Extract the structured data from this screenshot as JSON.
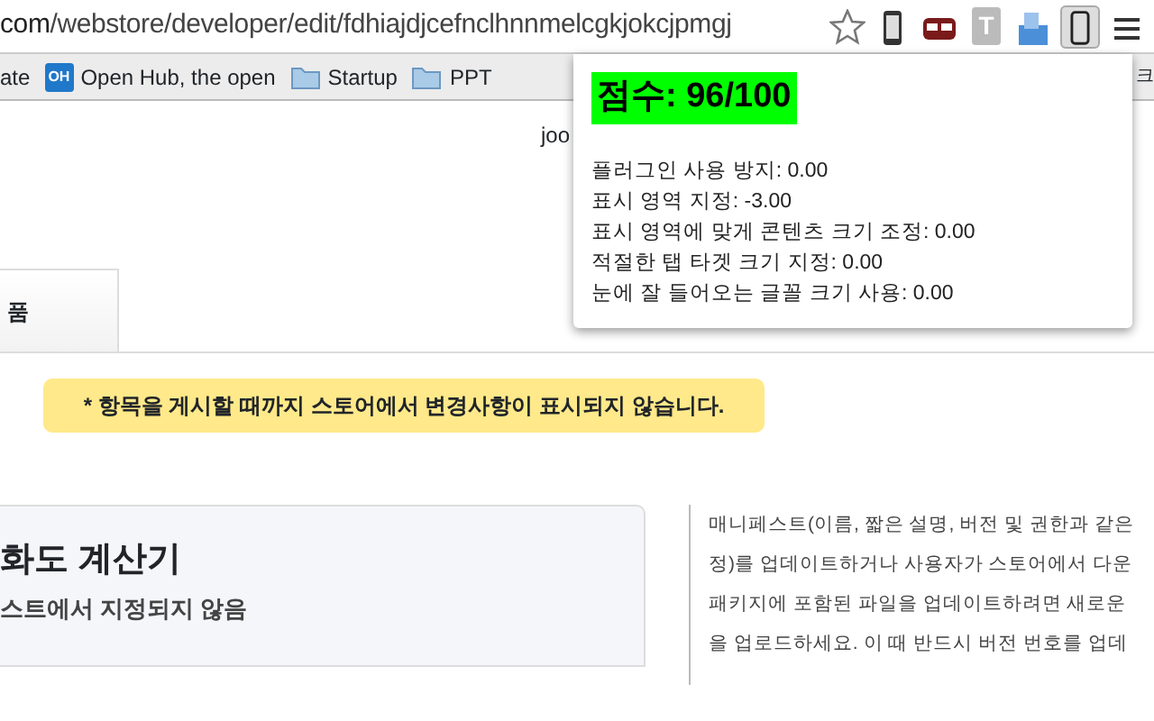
{
  "address_bar": {
    "url_host": "com",
    "url_path": "/webstore/developer/edit/fdhiajdjcefnclhnnmelcgkjokcjpmgj"
  },
  "toolbar_icons": [
    {
      "kind": "phone",
      "pressed": false
    },
    {
      "kind": "mask",
      "pressed": false
    },
    {
      "kind": "letter",
      "text": "T",
      "pressed": false
    },
    {
      "kind": "puzzle",
      "pressed": false
    },
    {
      "kind": "phone-outline",
      "pressed": true
    },
    {
      "kind": "menu",
      "pressed": false
    }
  ],
  "bookmarks": [
    {
      "kind": "text",
      "label": "ate"
    },
    {
      "kind": "site",
      "badge": "OH",
      "label": "Open Hub, the open"
    },
    {
      "kind": "folder",
      "label": "Startup"
    },
    {
      "kind": "folder",
      "label": "PPT"
    },
    {
      "kind": "text",
      "label": "크"
    }
  ],
  "page": {
    "user_text": "joo",
    "tab_label": "품",
    "notice": "* 항목을 게시할 때까지 스토어에서 변경사항이 표시되지 않습니다.",
    "card_title": "화도 계산기",
    "card_subtitle": "스트에서 지정되지 않음",
    "side_lines": [
      "매니페스트(이름, 짧은 설명, 버전 및 권한과 같은",
      "정)를 업데이트하거나 사용자가 스토어에서 다운",
      "패키지에 포함된 파일을 업데이트하려면 새로운",
      "을 업로드하세요. 이 때 반드시 버전 번호를 업데"
    ]
  },
  "popup": {
    "score": "점수: 96/100",
    "lines": [
      "플러그인 사용 방지: 0.00",
      "표시 영역 지정: -3.00",
      "표시 영역에 맞게 콘텐츠 크기 조정: 0.00",
      "적절한 탭 타겟 크기 지정: 0.00",
      "눈에 잘 들어오는 글꼴 크기 사용: 0.00"
    ]
  }
}
